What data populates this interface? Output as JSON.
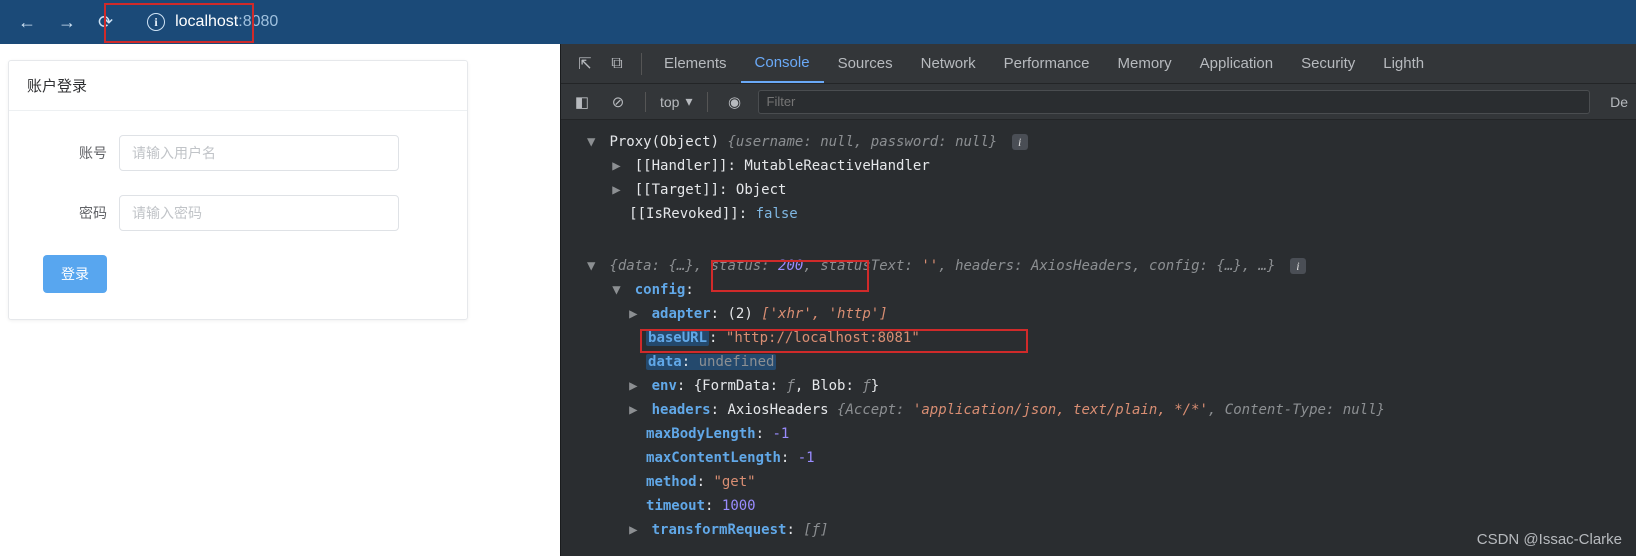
{
  "browser": {
    "url_host": "localhost",
    "url_port": ":8080"
  },
  "login": {
    "title": "账户登录",
    "username_label": "账号",
    "username_placeholder": "请输入用户名",
    "password_label": "密码",
    "password_placeholder": "请输入密码",
    "button": "登录"
  },
  "devtools": {
    "tabs": {
      "elements": "Elements",
      "console": "Console",
      "sources": "Sources",
      "network": "Network",
      "performance": "Performance",
      "memory": "Memory",
      "application": "Application",
      "security": "Security",
      "lighthouse": "Lighth"
    },
    "toolbar": {
      "context": "top",
      "filter_placeholder": "Filter",
      "trail": "De"
    },
    "console": {
      "proxy_prefix": "Proxy(Object) ",
      "proxy_open": "{",
      "proxy_user_key": "username: ",
      "proxy_user_val": "null",
      "proxy_sep": ", ",
      "proxy_pass_key": "password: ",
      "proxy_pass_val": "null",
      "proxy_close": "}",
      "handler_key": "[[Handler]]",
      "handler_val": "MutableReactiveHandler",
      "target_key": "[[Target]]",
      "target_val": "Object",
      "isrevoked_key": "[[IsRevoked]]",
      "isrevoked_val": "false",
      "resp_open": "{",
      "resp_data_key": "data: ",
      "resp_data_val": "{…}",
      "resp_status_key": "status: ",
      "resp_status_val": "200",
      "resp_statustext_key": "statusText: ",
      "resp_statustext_val": "''",
      "resp_headers_key": "headers: ",
      "resp_headers_val": "AxiosHeaders",
      "resp_config_key": "config: ",
      "resp_config_val": "{…}",
      "resp_rest": ", …",
      "resp_close": "}",
      "config_label": "config",
      "adapter_key": "adapter",
      "adapter_len": "(2) ",
      "adapter_val": "['xhr', 'http']",
      "baseurl_key": "baseURL",
      "baseurl_val": "\"http://localhost:8081\"",
      "data_key": "data",
      "data_val": "undefined",
      "env_key": "env",
      "env_val_open": "{FormData: ",
      "env_f1": "ƒ",
      "env_mid": ", Blob: ",
      "env_f2": "ƒ",
      "env_close": "}",
      "headers_key": "headers",
      "headers_cls": "AxiosHeaders ",
      "headers_accept_key": "{Accept: ",
      "headers_accept_val": "'application/json, text/plain, */*'",
      "headers_ct_key": ", Content-Type: ",
      "headers_ct_val": "null",
      "headers_close": "}",
      "maxbody_key": "maxBodyLength",
      "maxbody_val": "-1",
      "maxcontent_key": "maxContentLength",
      "maxcontent_val": "-1",
      "method_key": "method",
      "method_val": "\"get\"",
      "timeout_key": "timeout",
      "timeout_val": "1000",
      "transform_key": "transformRequest",
      "transform_val": "[ƒ]"
    }
  },
  "watermark": "CSDN @Issac-Clarke"
}
